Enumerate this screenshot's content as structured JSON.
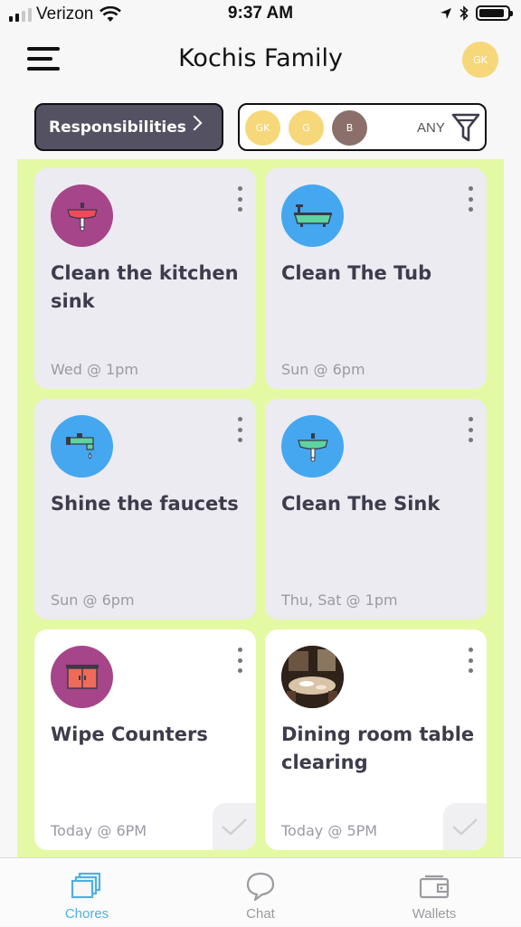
{
  "status_bar": {
    "carrier": "Verizon",
    "time": "9:37 AM"
  },
  "header": {
    "title": "Kochis Family",
    "user_initials": "GK"
  },
  "responsibilities_button": {
    "label": "Responsibilities"
  },
  "filter": {
    "members": [
      {
        "initials": "GK",
        "color": "#f6d77a"
      },
      {
        "initials": "G",
        "color": "#f6d77a"
      },
      {
        "initials": "B",
        "color": "#8a6f6b"
      }
    ],
    "any_label": "ANY"
  },
  "chores": [
    {
      "title": "Clean the kitchen sink",
      "schedule": "Wed @ 1pm",
      "icon": "bathroom-sink-icon",
      "icon_bg": "#a64589",
      "style": "gray"
    },
    {
      "title": "Clean The Tub",
      "schedule": "Sun @ 6pm",
      "icon": "bathtub-icon",
      "icon_bg": "#45a7f0",
      "style": "gray"
    },
    {
      "title": "Shine the faucets",
      "schedule": "Sun @ 6pm",
      "icon": "faucet-icon",
      "icon_bg": "#45a7f0",
      "style": "gray"
    },
    {
      "title": "Clean The Sink",
      "schedule": "Thu, Sat @ 1pm",
      "icon": "sink-icon",
      "icon_bg": "#45a7f0",
      "style": "gray"
    },
    {
      "title": "Wipe Counters",
      "schedule": "Today @ 6PM",
      "icon": "counter-icon",
      "icon_bg": "#a64589",
      "style": "white"
    },
    {
      "title": "Dining room table clearing",
      "schedule": "Today @ 5PM",
      "icon": "dining-room-photo",
      "icon_bg": "#3a2a20",
      "style": "white"
    }
  ],
  "tabs": [
    {
      "label": "Chores",
      "icon": "chores-stack-icon",
      "active": true
    },
    {
      "label": "Chat",
      "icon": "chat-bubble-icon",
      "active": false
    },
    {
      "label": "Wallets",
      "icon": "wallet-icon",
      "active": false
    }
  ],
  "colors": {
    "accent": "#4fb0e0",
    "grid_background": "#e4f9a3",
    "button_dark": "#545262",
    "inactive_tab": "#9b9ba0"
  }
}
